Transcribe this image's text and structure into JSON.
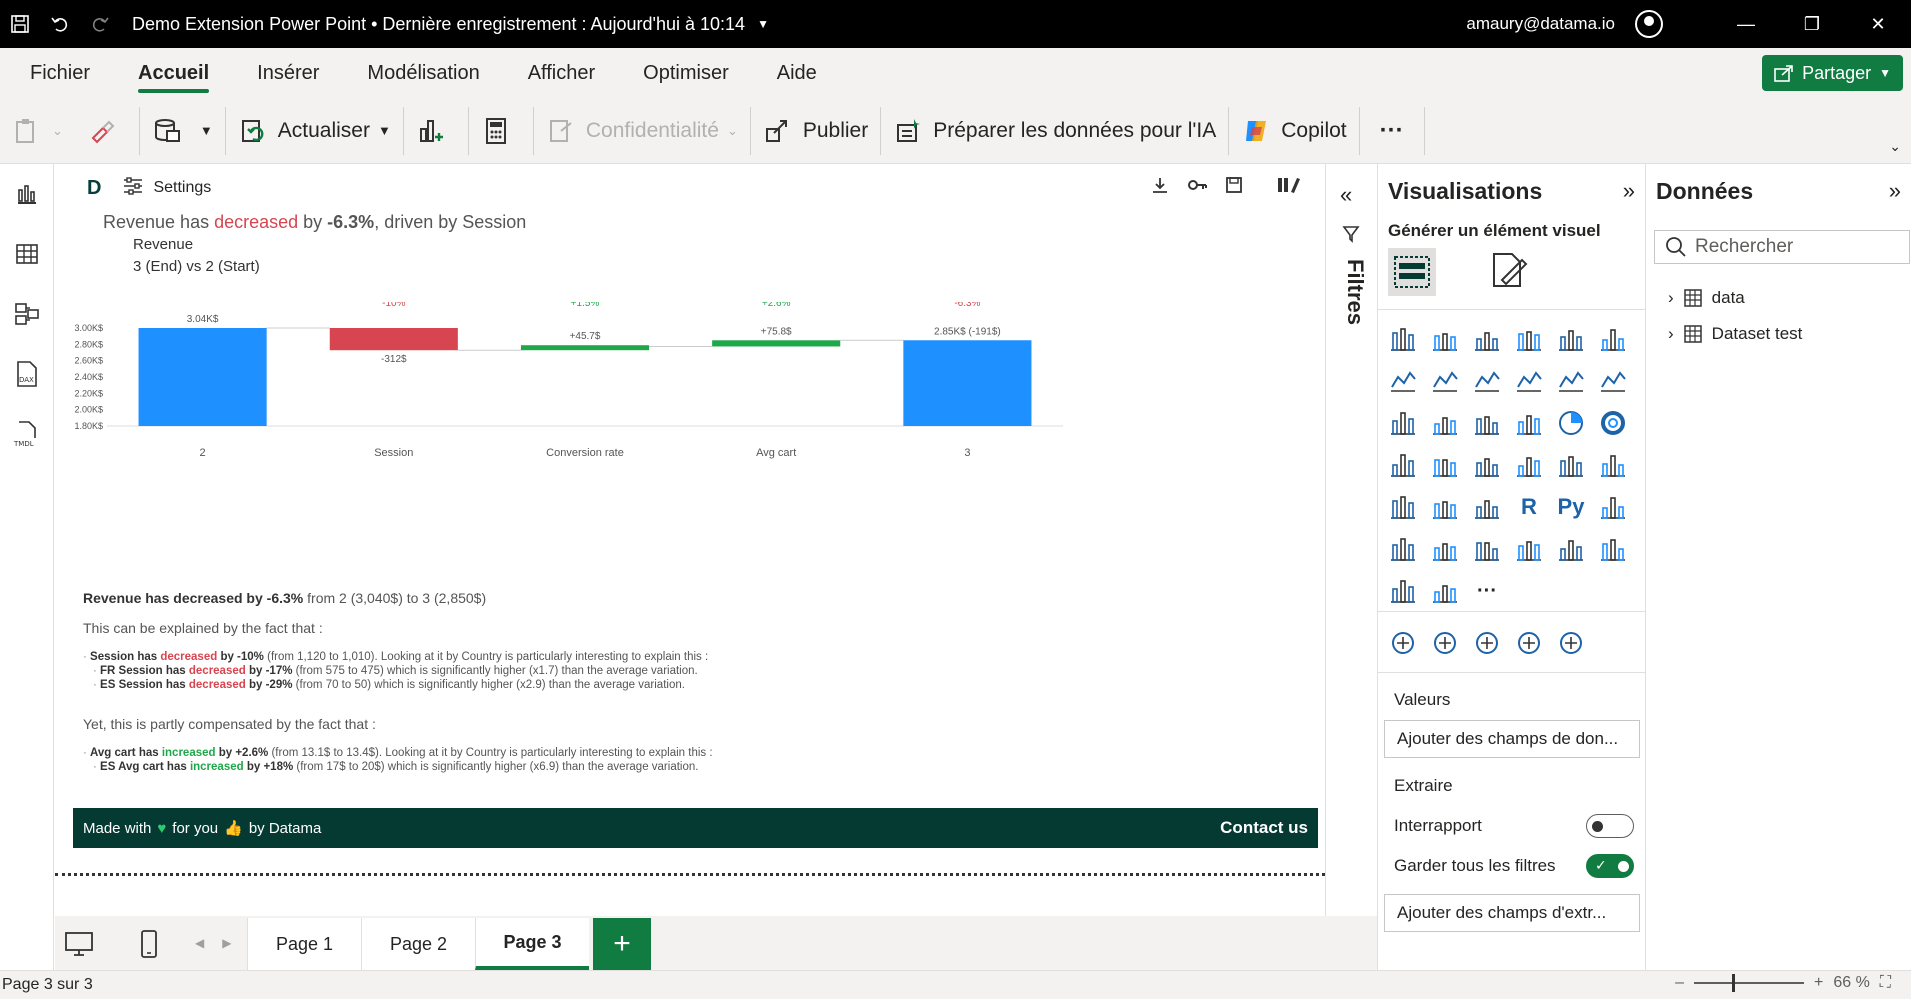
{
  "titlebar": {
    "title": "Demo Extension Power Point • Dernière enregistrement : Aujourd'hui à 10:14",
    "user": "amaury@datama.io"
  },
  "menu": {
    "items": [
      "Fichier",
      "Accueil",
      "Insérer",
      "Modélisation",
      "Afficher",
      "Optimiser",
      "Aide"
    ],
    "active": "Accueil",
    "share_label": "Partager"
  },
  "ribbon": {
    "refresh": "Actualiser",
    "privacy": "Confidentialité",
    "publish": "Publier",
    "prepare_ai": "Préparer les données pour l'IA",
    "copilot": "Copilot",
    "more": "···"
  },
  "visual": {
    "logo": "D",
    "settings_label": "Settings",
    "insight": {
      "prefix": "Revenue has ",
      "verb": "decreased",
      "mid": " by ",
      "value": "-6.3%",
      "suffix": ", driven by Session"
    },
    "metric_label": "Revenue",
    "comparison_label": "3 (End) vs 2 (Start)",
    "narrative": {
      "headline_a": "Revenue has ",
      "headline_verb": "decreased",
      "headline_b": " by -6.3%",
      "headline_c": " from 2 (3,040$) to 3 (2,850$)",
      "explain_intro": "This can be explained by the fact that :",
      "explain_items": [
        {
          "bold": "Session has ",
          "verb": "decreased",
          "bold2": " by -10%",
          "rest": " (from 1,120 to 1,010). Looking at it by Country is particularly interesting to explain this :",
          "sub": false
        },
        {
          "bold": "FR Session has ",
          "verb": "decreased",
          "bold2": " by -17%",
          "rest": " (from 575 to 475) which is significantly higher (x1.7) than the average variation.",
          "sub": true
        },
        {
          "bold": "ES Session has ",
          "verb": "decreased",
          "bold2": " by -29%",
          "rest": " (from 70 to 50) which is significantly higher (x2.9) than the average variation.",
          "sub": true
        }
      ],
      "compensate_intro": "Yet, this is partly compensated by the fact that :",
      "compensate_items": [
        {
          "bold": "Avg cart has ",
          "verb": "increased",
          "bold2": " by +2.6%",
          "rest": " (from 13.1$ to 13.4$). Looking at it by Country is particularly interesting to explain this :",
          "sub": false
        },
        {
          "bold": "ES Avg cart has ",
          "verb": "increased",
          "bold2": " by +18%",
          "rest": " (from 17$ to 20$) which is significantly higher (x6.9) than the average variation.",
          "sub": true
        }
      ]
    },
    "footer": {
      "made_with": "Made with",
      "for_you": "for you",
      "by": "by Datama",
      "contact": "Contact us"
    }
  },
  "chart_data": {
    "type": "bar",
    "subtype": "waterfall",
    "categories": [
      "2",
      "Session",
      "Conversion rate",
      "Avg cart",
      "3"
    ],
    "start": 3040,
    "end": 2850,
    "deltas": [
      -312,
      45.7,
      75.8
    ],
    "pct_labels": [
      "-10%",
      "+1.5%",
      "+2.6%",
      "-6.3%"
    ],
    "bar_labels": [
      "3.04K$",
      "-312$",
      "+45.7$",
      "+75.8$",
      "2.85K$ (-191$)"
    ],
    "ylim": [
      1800,
      3000
    ],
    "yticks": [
      "1.80K$",
      "2.00K$",
      "2.20K$",
      "2.40K$",
      "2.60K$",
      "2.80K$",
      "3.00K$"
    ],
    "ytick_values": [
      1800,
      2000,
      2200,
      2400,
      2600,
      2800,
      3000
    ],
    "colors": {
      "total": "#1e90ff",
      "negative": "#d64550",
      "positive": "#1fa84a"
    }
  },
  "filters": {
    "label": "Filtres"
  },
  "viz_pane": {
    "title": "Visualisations",
    "subtitle": "Générer un élément visuel",
    "values_label": "Valeurs",
    "values_placeholder": "Ajouter des champs de don...",
    "drill_label": "Extraire",
    "cross_report": "Interrapport",
    "keep_filters": "Garder tous les filtres",
    "drill_placeholder": "Ajouter des champs d'extr..."
  },
  "data_pane": {
    "title": "Données",
    "search_placeholder": "Rechercher",
    "tables": [
      "data",
      "Dataset test"
    ]
  },
  "pages": {
    "tabs": [
      "Page 1",
      "Page 2",
      "Page 3"
    ],
    "active": "Page 3",
    "add": "+"
  },
  "status": {
    "page_info": "Page 3 sur 3",
    "zoom": "66 %"
  }
}
